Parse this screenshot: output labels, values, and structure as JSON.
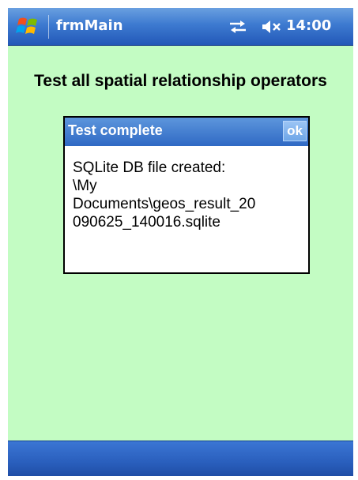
{
  "title_bar": {
    "app_title": "frmMain",
    "clock": "14:00",
    "start_icon": "windows-flag-icon",
    "connectivity_icon": "sync-arrows-icon",
    "volume_icon": "volume-muted-icon"
  },
  "main": {
    "heading": "Test all spatial relationship operators"
  },
  "dialog": {
    "title": "Test complete",
    "ok_label": "ok",
    "message_lines": [
      "SQLite DB file created:",
      "\\My",
      "Documents\\geos_result_20",
      "090625_140016.sqlite"
    ]
  },
  "colors": {
    "background": "#c3fcc3",
    "titlebar": "#2f69c4",
    "dialog_bg": "#ffffff"
  }
}
